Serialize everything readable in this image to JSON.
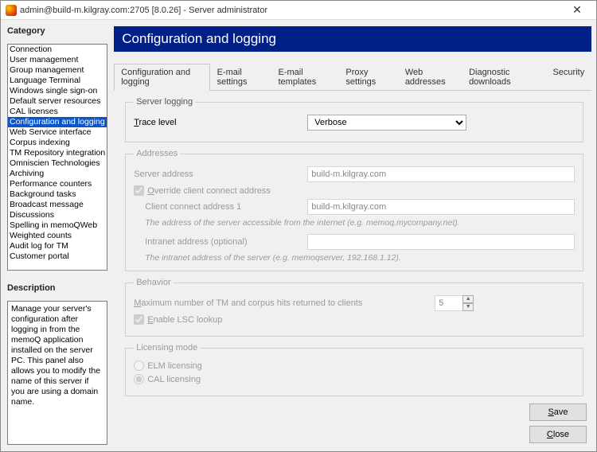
{
  "window": {
    "title": "admin@build-m.kilgray.com:2705 [8.0.26] - Server administrator"
  },
  "left_panel": {
    "category_label": "Category",
    "description_label": "Description",
    "description_text": "Manage your server's configuration after logging in from the memoQ application installed on the server PC. This panel also allows you to modify the name of this server if you are using a domain name."
  },
  "categories": [
    "Connection",
    "User management",
    "Group management",
    "Language Terminal",
    "Windows single sign-on",
    "Default server resources",
    "CAL licenses",
    "Configuration and logging",
    "Web Service interface",
    "Corpus indexing",
    "TM Repository integration",
    "Omniscien Technologies",
    "Archiving",
    "Performance counters",
    "Background tasks",
    "Broadcast message",
    "Discussions",
    "Spelling in memoQWeb",
    "Weighted counts",
    "Audit log for TM",
    "Customer portal"
  ],
  "selected_category_index": 7,
  "header_title": "Configuration and logging",
  "tabs": [
    "Configuration and logging",
    "E-mail settings",
    "E-mail templates",
    "Proxy settings",
    "Web addresses",
    "Diagnostic downloads",
    "Security"
  ],
  "active_tab_index": 0,
  "logging": {
    "group_label": "Server logging",
    "trace_label": "Trace level",
    "trace_value": "Verbose"
  },
  "addresses": {
    "group_label": "Addresses",
    "server_address_label": "Server address",
    "server_address_value": "build-m.kilgray.com",
    "override_label": "Override client connect address",
    "override_checked": true,
    "client_addr_label": "Client connect address 1",
    "client_addr_value": "build-m.kilgray.com",
    "client_addr_hint": "The address of the server accessible from the internet (e.g. memoq.mycompany.net).",
    "intranet_label": "Intranet address (optional)",
    "intranet_value": "",
    "intranet_hint": "The intranet address of the server (e.g. memoqserver, 192.168.1.12)."
  },
  "behavior": {
    "group_label": "Behavior",
    "max_hits_label": "Maximum number of TM and corpus hits returned to clients",
    "max_hits_value": "5",
    "lsc_label": "Enable LSC lookup",
    "lsc_checked": true
  },
  "licensing": {
    "group_label": "Licensing mode",
    "elm_label": "ELM licensing",
    "cal_label": "CAL licensing",
    "selected": "cal"
  },
  "buttons": {
    "save": "Save",
    "close": "Close"
  }
}
